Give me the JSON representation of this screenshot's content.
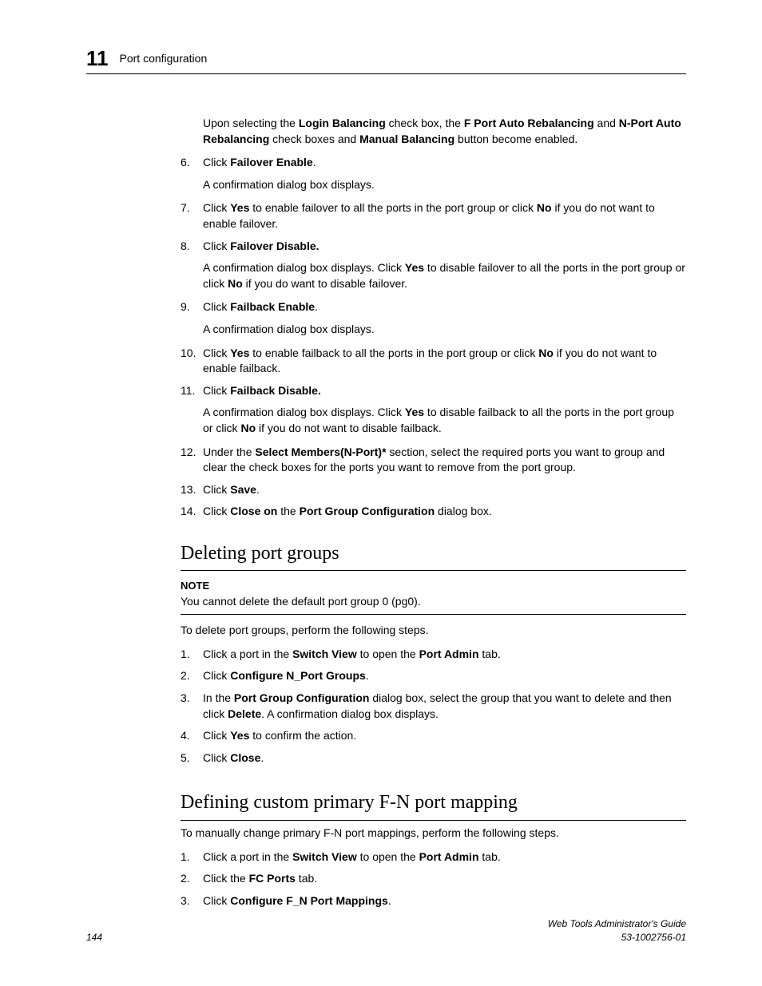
{
  "header": {
    "chapter_number": "11",
    "chapter_title": "Port configuration"
  },
  "intro_para_html": "Upon selecting the <b>Login Balancing</b> check box, the <b>F Port Auto Rebalancing</b> and <b>N-Port Auto Rebalancing</b> check boxes and <b>Manual Balancing</b> button become enabled.",
  "steps_a": [
    {
      "n": "6.",
      "body_html": "Click <b>Failover Enable</b>.",
      "after_html": "A confirmation dialog box displays."
    },
    {
      "n": "7.",
      "body_html": "Click <b>Yes</b> to enable failover to all the ports in the port group or click <b>No</b> if you do not want to enable failover.",
      "after_html": ""
    },
    {
      "n": "8.",
      "body_html": "Click <b>Failover Disable.</b>",
      "after_html": "A confirmation dialog box displays. Click <b>Yes</b> to disable failover to all the ports in the port group or click <b>No</b> if you do want to disable failover."
    },
    {
      "n": "9.",
      "body_html": "Click <b>Failback Enable</b>.",
      "after_html": "A confirmation dialog box displays."
    },
    {
      "n": "10.",
      "body_html": "Click <b>Yes</b> to enable failback to all the ports in the port group or click <b>No</b> if you do not want to enable failback.",
      "after_html": ""
    },
    {
      "n": "11.",
      "body_html": "Click <b>Failback Disable.</b>",
      "after_html": "A confirmation dialog box displays. Click <b>Yes</b> to disable failback to all the ports in the port group or click <b>No</b> if you do not want to disable failback."
    },
    {
      "n": "12.",
      "body_html": "Under the <b>Select Members(N-Port)*</b> section, select the required ports you want to group and clear the check boxes for the ports you want to remove from the port group.",
      "after_html": ""
    },
    {
      "n": "13.",
      "body_html": "Click <b>Save</b>.",
      "after_html": ""
    },
    {
      "n": "14.",
      "body_html": "Click <b>Close on</b> the <b>Port Group Configuration</b> dialog box.",
      "after_html": ""
    }
  ],
  "section_b": {
    "title": "Deleting port groups",
    "note_label": "NOTE",
    "note_body": "You cannot delete the default port group 0 (pg0).",
    "lead": "To delete port groups, perform the following steps.",
    "steps": [
      {
        "n": "1.",
        "body_html": "Click a port in the <b>Switch View</b> to open the <b>Port Admin</b> tab."
      },
      {
        "n": "2.",
        "body_html": "Click <b>Configure N_Port Groups</b>."
      },
      {
        "n": "3.",
        "body_html": "In the <b>Port Group Configuration</b> dialog box, select the group that you want to delete and then click <b>Delete</b>. A confirmation dialog box displays."
      },
      {
        "n": "4.",
        "body_html": "Click <b>Yes</b> to confirm the action."
      },
      {
        "n": "5.",
        "body_html": "Click <b>Close</b>."
      }
    ]
  },
  "section_c": {
    "title": "Defining custom primary F-N port mapping",
    "lead": "To manually change primary F-N port mappings, perform the following steps.",
    "steps": [
      {
        "n": "1.",
        "body_html": "Click a port in the <b>Switch View</b> to open the <b>Port Admin</b> tab."
      },
      {
        "n": "2.",
        "body_html": "Click the <b>FC Ports</b> tab."
      },
      {
        "n": "3.",
        "body_html": "Click <b>Configure F_N Port Mappings</b>."
      }
    ]
  },
  "footer": {
    "page": "144",
    "title": "Web Tools Administrator's Guide",
    "docnum": "53-1002756-01"
  }
}
